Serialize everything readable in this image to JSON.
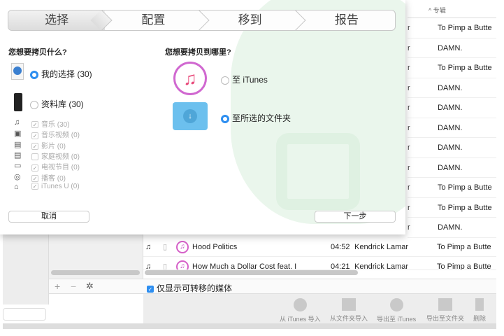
{
  "dialog": {
    "steps": [
      "选择",
      "配置",
      "移到",
      "报告"
    ],
    "what_label": "您想要拷贝什么?",
    "where_label": "您想要拷贝到哪里?",
    "source_options": [
      {
        "label": "我的选择 (30)",
        "selected": true
      },
      {
        "label": "资料库 (30)",
        "selected": false
      }
    ],
    "media_types": [
      {
        "icon": "music-note-icon",
        "label": "音乐 (30)",
        "checked": true
      },
      {
        "icon": "music-video-icon",
        "label": "音乐视频 (0)",
        "checked": true
      },
      {
        "icon": "film-icon",
        "label": "影片 (0)",
        "checked": true
      },
      {
        "icon": "home-video-icon",
        "label": "家庭视频  (0)",
        "checked": false
      },
      {
        "icon": "tv-icon",
        "label": "电视节目 (0)",
        "checked": true
      },
      {
        "icon": "podcast-icon",
        "label": "播客 (0)",
        "checked": true
      },
      {
        "icon": "graduation-cap-icon",
        "label": "iTunes U (0)",
        "checked": true
      }
    ],
    "dest_options": [
      {
        "label": "至 iTunes",
        "selected": false
      },
      {
        "label": "至所选的文件夹",
        "selected": true
      }
    ],
    "cancel": "取消",
    "next": "下一步"
  },
  "table": {
    "album_header": "专辑",
    "artist_fragment": "r",
    "albums": [
      "To Pimp a Butte",
      "DAMN.",
      "To Pimp a Butte",
      "DAMN.",
      "DAMN.",
      "DAMN.",
      "DAMN.",
      "DAMN.",
      "To Pimp a Butte",
      "To Pimp a Butte",
      "DAMN."
    ],
    "tracks": [
      {
        "title": "Hood Politics",
        "time": "04:52",
        "artist": "Kendrick Lamar",
        "album": "To Pimp a Butte"
      },
      {
        "title": "How Much a Dollar Cost feat. I",
        "time": "04:21",
        "artist": "Kendrick Lamar",
        "album": "To Pimp a Butte"
      }
    ]
  },
  "filter": {
    "label": "仅显示可转移的媒体",
    "checked": true
  },
  "list_controls": {
    "add": "+",
    "remove": "−",
    "settings": "✲"
  },
  "toolbar": [
    "从 iTunes 导入",
    "从文件夹导入",
    "导出至 iTunes",
    "导出至文件夹",
    "删除"
  ],
  "colors": {
    "accent": "#2d8ef0"
  }
}
